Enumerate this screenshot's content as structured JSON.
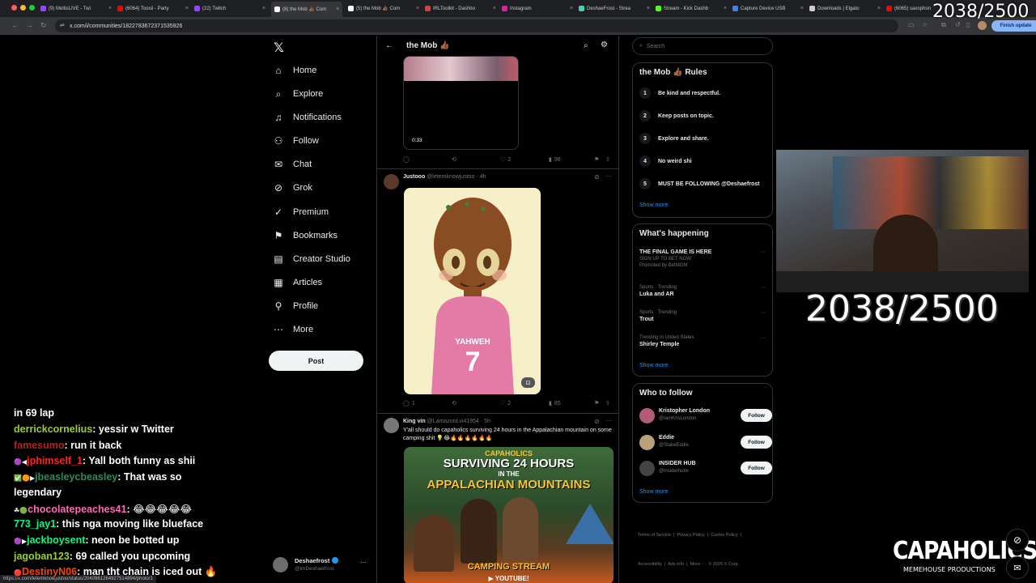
{
  "browser": {
    "tabs": [
      {
        "label": "(9) MeltisLIVE - Twi",
        "color": "#9146ff",
        "active": false
      },
      {
        "label": "(6064) Toosii - Party",
        "color": "#ff0000",
        "active": false
      },
      {
        "label": "(22) Twitch",
        "color": "#9146ff",
        "active": false
      },
      {
        "label": "(8) the Mob 👍🏾 Com",
        "color": "#ffffff",
        "active": true
      },
      {
        "label": "(5) the Mob 👍🏾 Com",
        "color": "#ffffff",
        "active": false
      },
      {
        "label": "IRLToolkit - Dashbo",
        "color": "#e33b3b",
        "active": false
      },
      {
        "label": "Instagram",
        "color": "#d6249f",
        "active": false
      },
      {
        "label": "DeshaeFrost - Strea",
        "color": "#3bd6b5",
        "active": false
      },
      {
        "label": "Stream - Kick Dashb",
        "color": "#53fc18",
        "active": false
      },
      {
        "label": "Capture Device USB",
        "color": "#3b82f6",
        "active": false
      },
      {
        "label": "Downloads | Elgato",
        "color": "#cccccc",
        "active": false
      },
      {
        "label": "(6065) saxophon",
        "color": "#ff0000",
        "active": false
      }
    ],
    "url": "x.com/i/communities/1822783672371535926",
    "finish_update": "Finish update"
  },
  "overlay": {
    "counter": "2038/2500",
    "brand_main": "CAPAHOLICS",
    "brand_sub": "MEMEHOUSE PRODUCTIONS"
  },
  "sidebar": {
    "items": [
      {
        "label": "Home",
        "icon": "home-icon",
        "glyph": "⌂"
      },
      {
        "label": "Explore",
        "icon": "search-icon",
        "glyph": "⌕"
      },
      {
        "label": "Notifications",
        "icon": "bell-icon",
        "glyph": "♫"
      },
      {
        "label": "Follow",
        "icon": "person-plus-icon",
        "glyph": "⚇"
      },
      {
        "label": "Chat",
        "icon": "chat-icon",
        "glyph": "✉"
      },
      {
        "label": "Grok",
        "icon": "grok-icon",
        "glyph": "⊘"
      },
      {
        "label": "Premium",
        "icon": "premium-icon",
        "glyph": "✓"
      },
      {
        "label": "Bookmarks",
        "icon": "bookmark-icon",
        "glyph": "⚑"
      },
      {
        "label": "Creator Studio",
        "icon": "creator-studio-icon",
        "glyph": "▤"
      },
      {
        "label": "Articles",
        "icon": "articles-icon",
        "glyph": "▦"
      },
      {
        "label": "Profile",
        "icon": "profile-icon",
        "glyph": "⚲"
      },
      {
        "label": "More",
        "icon": "more-icon",
        "glyph": "⋯"
      }
    ],
    "post_label": "Post",
    "account_name": "Deshaefrost",
    "account_handle": "@imDeshaefrost"
  },
  "feed": {
    "header_title": "the Mob 👍🏾",
    "tweet1": {
      "duration": "0:33",
      "replies": "",
      "likes": "2",
      "views": "96"
    },
    "tweet2": {
      "name": "Justooo",
      "handle": "@letemknowjustoo",
      "time": "· 4h",
      "jersey_name": "YAHWEH",
      "jersey_number": "7",
      "replies": "1",
      "likes": "2",
      "views": "85"
    },
    "tweet3": {
      "name": "King vin",
      "handle": "@LamazonLvi41954",
      "time": "· 5h",
      "text": "Y'all should do capaholics surviving 24 hours in the Appalachian mountain on some camping shit 💡😂🔥🔥🔥🔥🔥🔥",
      "thumb_top": "CAPAHOLICS",
      "thumb_l1": "SURVIVING 24 HOURS",
      "thumb_l2": "IN THE",
      "thumb_l3": "APPALACHIAN MOUNTAINS",
      "thumb_bottom": "CAMPING STREAM",
      "thumb_yt": "YOUTUBE!"
    },
    "status_link": "https://x.com/letemknowjustoo/status/2040961264927514894/photo/1"
  },
  "right": {
    "search_placeholder": "Search",
    "rules_title": "the Mob 👍🏾 Rules",
    "rules": [
      {
        "num": "1",
        "text": "Be kind and respectful."
      },
      {
        "num": "2",
        "text": "Keep posts on topic."
      },
      {
        "num": "3",
        "text": "Explore and share."
      },
      {
        "num": "4",
        "text": "No weird shi"
      },
      {
        "num": "5",
        "text": "MUST BE FOLLOWING @Deshaefrost"
      }
    ],
    "show_more": "Show more",
    "happening_title": "What's happening",
    "trends": [
      {
        "meta": "",
        "title": "THE FINAL GAME IS HERE",
        "sub": "SIGN UP TO BET NOW",
        "promo": "Promoted by BetMGM"
      },
      {
        "meta": "Sports · Trending",
        "title": "Luka and AR"
      },
      {
        "meta": "Sports · Trending",
        "title": "Trout"
      },
      {
        "meta": "Trending in United States",
        "title": "Shirley Temple"
      }
    ],
    "wtf_title": "Who to follow",
    "wtf": [
      {
        "name": "Kristopher London",
        "handle": "@IamKrisLondon",
        "color": "#b25b7a"
      },
      {
        "name": "Eddie",
        "handle": "@StakeEddie",
        "color": "#b8a27a"
      },
      {
        "name": "INSIDER HUB",
        "handle": "@insiderhubx",
        "color": "#444"
      }
    ],
    "follow_label": "Follow",
    "footer_l1": "Terms of Service  |  Privacy Policy  |  Cookie Policy  |",
    "footer_l2": "Accessibility  |  Ads info  |  More ···  © 2026 X Corp."
  },
  "chat": [
    {
      "user": "",
      "color": "#ffffff",
      "msg": "in 69 lap",
      "badges": ""
    },
    {
      "user": "derrickcornelius",
      "color": "#9acd32",
      "msg": ": yessir w Twitter",
      "badges": ""
    },
    {
      "user": "famesumo",
      "color": "#b22222",
      "msg": ": run it back",
      "badges": ""
    },
    {
      "user": "jphimself_1",
      "color": "#ff2020",
      "msg": ": Yall both funny as shii",
      "badges": "🟣◀"
    },
    {
      "user": "jbeasleycbeasley",
      "color": "#2e8b57",
      "msg": ": That was so",
      "badges": "✅🟠▶"
    },
    {
      "user": "",
      "color": "#ffffff",
      "msg": "legendary",
      "badges": ""
    },
    {
      "user": "chocolatepeaches41",
      "color": "#ff69b4",
      "msg": ": 😂😂😂😂😂",
      "badges": "☘🟢"
    },
    {
      "user": "773_jay1",
      "color": "#00ff7f",
      "msg": ": this nga moving like blueface",
      "badges": ""
    },
    {
      "user": "jackboysent",
      "color": "#00ff7f",
      "msg": ": neon be botted up",
      "badges": "🟣▶"
    },
    {
      "user": "jagoban123",
      "color": "#9acd32",
      "msg": ": 69 called you upcoming",
      "badges": ""
    },
    {
      "user": "DestinyN06",
      "color": "#ff4500",
      "msg": ": man tht chain is iced out 🔥",
      "badges": "🔴"
    }
  ]
}
